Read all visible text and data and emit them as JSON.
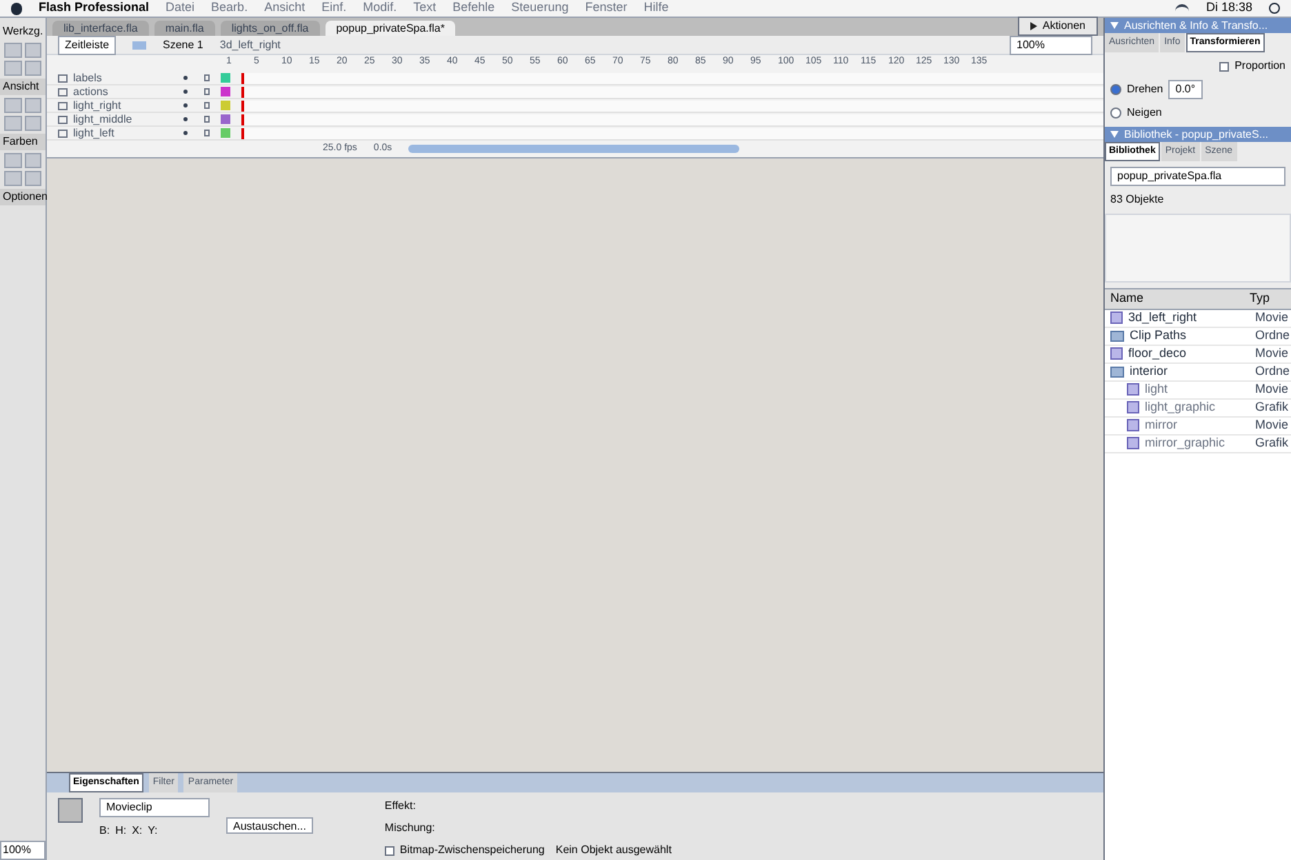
{
  "menu_bar": {
    "app": "Flash Professional",
    "items": [
      "Datei",
      "Bearb.",
      "Ansicht",
      "Einf.",
      "Modif.",
      "Text",
      "Befehle",
      "Steuerung",
      "Fenster",
      "Hilfe"
    ],
    "clock": "Di 18:38"
  },
  "tools_panel": {
    "title": "Werkzg.",
    "sections": [
      "Ansicht",
      "Farben",
      "Optionen"
    ]
  },
  "document_tabs": [
    {
      "label": "lib_interface.fla",
      "selected": false
    },
    {
      "label": "main.fla",
      "selected": false
    },
    {
      "label": "lights_on_off.fla",
      "selected": false
    },
    {
      "label": "popup_privateSpa.fla*",
      "selected": true
    }
  ],
  "actions_panel": {
    "title": "Aktionen"
  },
  "edit_bar": {
    "timeline_button": "Zeitleiste",
    "scene": "Szene 1",
    "symbol": "3d_left_right",
    "zoom": "100%"
  },
  "timeline": {
    "ruler": [
      "1",
      "5",
      "10",
      "15",
      "20",
      "25",
      "30",
      "35",
      "40",
      "45",
      "50",
      "55",
      "60",
      "65",
      "70",
      "75",
      "80",
      "85",
      "90",
      "95",
      "100",
      "105",
      "110",
      "115",
      "120",
      "125",
      "130",
      "135"
    ],
    "layers": [
      {
        "name": "labels",
        "color": "#33cc99"
      },
      {
        "name": "actions",
        "color": "#cc33cc"
      },
      {
        "name": "light_right",
        "color": "#cccc33"
      },
      {
        "name": "light_middle",
        "color": "#9966cc"
      },
      {
        "name": "light_left",
        "color": "#66cc66"
      }
    ],
    "fps": "25.0 fps",
    "time": "0.0s"
  },
  "properties": {
    "tabs": [
      {
        "label": "Eigenschaften",
        "selected": true
      },
      {
        "label": "Filter",
        "selected": false
      },
      {
        "label": "Parameter",
        "selected": false
      }
    ],
    "symbol_type": "Movieclip",
    "swap_button": "Austauschen...",
    "effect_label": "Effekt:",
    "blend_label": "Mischung:",
    "width_label": "B:",
    "height_label": "H:",
    "x_label": "X:",
    "y_label": "Y:",
    "cache": {
      "label": "Bitmap-Zwischenspeicherung",
      "checked": false
    },
    "status": "Kein Objekt ausgewählt"
  },
  "stage_zoom": "100%",
  "transform_panel": {
    "header": "Ausrichten & Info & Transfo...",
    "tabs": [
      {
        "label": "Ausrichten",
        "selected": false
      },
      {
        "label": "Info",
        "selected": false
      },
      {
        "label": "Transformieren",
        "selected": true
      }
    ],
    "proportion": {
      "label": "Proportion",
      "checked": false
    },
    "rotate": {
      "label": "Drehen",
      "value": "0.0°",
      "selected": true
    },
    "skew": {
      "label": "Neigen",
      "selected": false
    }
  },
  "library_panel": {
    "header": "Bibliothek - popup_privateS...",
    "tabs": [
      {
        "label": "Bibliothek",
        "selected": true
      },
      {
        "label": "Projekt",
        "selected": false
      },
      {
        "label": "Szene",
        "selected": false
      }
    ],
    "file": "popup_privateSpa.fla",
    "count": "83 Objekte",
    "columns": [
      "Name",
      "Typ"
    ],
    "items": [
      {
        "name": "3d_left_right",
        "type": "Movie",
        "kind": "symbol"
      },
      {
        "name": "Clip Paths",
        "type": "Ordne",
        "kind": "folder"
      },
      {
        "name": "floor_deco",
        "type": "Movie",
        "kind": "symbol"
      },
      {
        "name": "interior",
        "type": "Ordne",
        "kind": "folder",
        "children": [
          {
            "name": "light",
            "type": "Movie",
            "kind": "symbol"
          },
          {
            "name": "light_graphic",
            "type": "Grafik",
            "kind": "symbol"
          },
          {
            "name": "mirror",
            "type": "Movie",
            "kind": "symbol"
          },
          {
            "name": "mirror_graphic",
            "type": "Grafik",
            "kind": "symbol"
          }
        ]
      }
    ]
  }
}
